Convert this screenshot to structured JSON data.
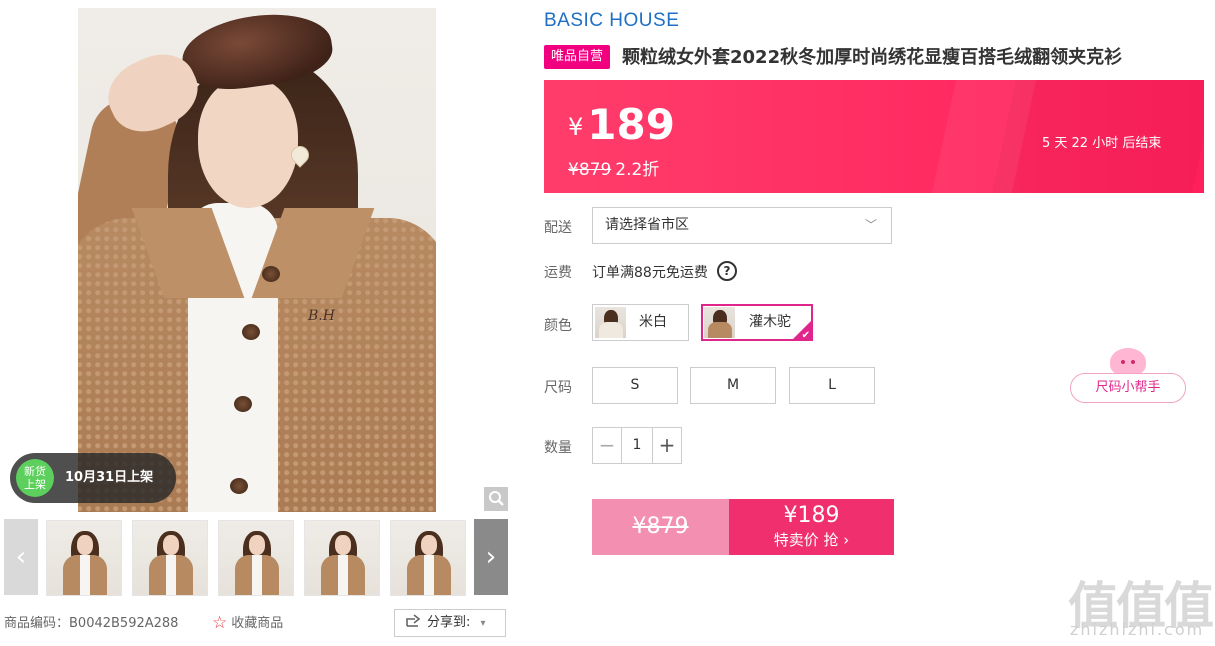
{
  "gallery": {
    "badge_line1": "新货",
    "badge_line2": "上架",
    "badge_text": "10月31日上架",
    "thumb_count": 5
  },
  "meta": {
    "product_code": "商品编码：B0042B592A288",
    "favorite": "收藏商品",
    "share": "分享到:"
  },
  "product": {
    "brand": "BASIC HOUSE",
    "tag": "唯品自营",
    "title": "颗粒绒女外套2022秋冬加厚时尚绣花显瘦百搭毛绒翻领夹克衫"
  },
  "price": {
    "currency": "¥",
    "sale": "189",
    "original": "¥879",
    "discount": "2.2折",
    "countdown": "5 天 22 小时 后结束"
  },
  "options": {
    "shipping_label": "配送",
    "shipping_placeholder": "请选择省市区",
    "freight_label": "运费",
    "freight_text": "订单满88元免运费",
    "color_label": "颜色",
    "colors": [
      {
        "name": "米白",
        "swatch": "#efe9df",
        "selected": false
      },
      {
        "name": "灌木驼",
        "swatch": "#b88a62",
        "selected": true
      }
    ],
    "size_label": "尺码",
    "sizes": [
      "S",
      "M",
      "L"
    ],
    "size_helper": "尺码小帮手",
    "qty_label": "数量",
    "qty_value": "1"
  },
  "buy": {
    "orig_price": "¥879",
    "price": "¥189",
    "label": "特卖价 抢"
  },
  "watermark": {
    "big": "值值值",
    "small": "zhizhizhi.com"
  },
  "colors": {
    "brand_blue": "#1f6fc4",
    "vip_pink": "#f10180",
    "banner_red": "#ff2b62",
    "buy_pink": "#ef2f6e"
  }
}
